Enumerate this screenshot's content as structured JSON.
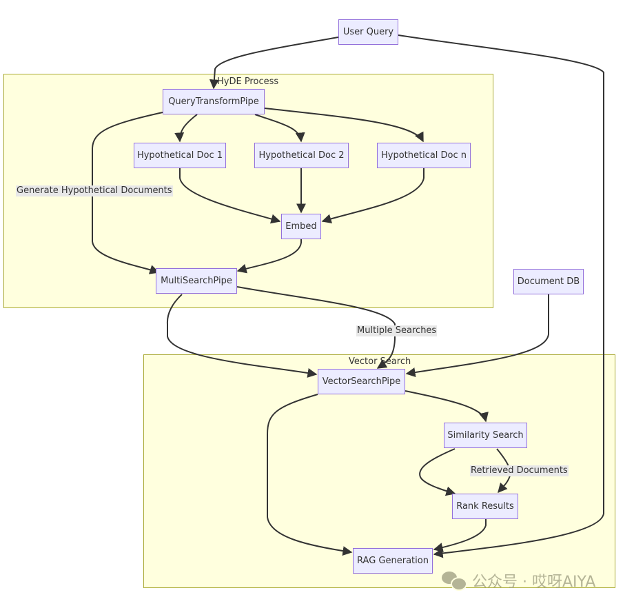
{
  "diagram": {
    "type": "flowchart",
    "colors": {
      "node_fill": "#ececff",
      "node_border": "#9370db",
      "cluster_fill": "#ffffde",
      "cluster_border": "#aaaa33",
      "edge": "#333333",
      "edge_label_bg": "#e8e8e8",
      "text": "#333333"
    },
    "clusters": {
      "hyde": {
        "title": "HyDE Process"
      },
      "vector": {
        "title": "Vector Search"
      }
    },
    "nodes": {
      "user_query": "User Query",
      "query_transform": "QueryTransformPipe",
      "hyp_doc_1": "Hypothetical Doc 1",
      "hyp_doc_2": "Hypothetical Doc 2",
      "hyp_doc_n": "Hypothetical Doc n",
      "embed": "Embed",
      "multi_search": "MultiSearchPipe",
      "document_db": "Document DB",
      "vector_search_pipe": "VectorSearchPipe",
      "similarity_search": "Similarity Search",
      "rank_results": "Rank Results",
      "rag_generation": "RAG Generation"
    },
    "edges": [
      {
        "from": "user_query",
        "to": "query_transform",
        "label": ""
      },
      {
        "from": "user_query",
        "to": "rag_generation",
        "label": ""
      },
      {
        "from": "query_transform",
        "to": "hyp_doc_1",
        "label": ""
      },
      {
        "from": "query_transform",
        "to": "hyp_doc_2",
        "label": ""
      },
      {
        "from": "query_transform",
        "to": "hyp_doc_n",
        "label": ""
      },
      {
        "from": "query_transform",
        "to": "multi_search",
        "label": "Generate Hypothetical Documents"
      },
      {
        "from": "hyp_doc_1",
        "to": "embed",
        "label": ""
      },
      {
        "from": "hyp_doc_2",
        "to": "embed",
        "label": ""
      },
      {
        "from": "hyp_doc_n",
        "to": "embed",
        "label": ""
      },
      {
        "from": "embed",
        "to": "multi_search",
        "label": ""
      },
      {
        "from": "multi_search",
        "to": "vector_search_pipe",
        "label": ""
      },
      {
        "from": "multi_search",
        "to": "vector_search_pipe",
        "label": "Multiple Searches"
      },
      {
        "from": "document_db",
        "to": "vector_search_pipe",
        "label": ""
      },
      {
        "from": "vector_search_pipe",
        "to": "similarity_search",
        "label": ""
      },
      {
        "from": "vector_search_pipe",
        "to": "rag_generation",
        "label": ""
      },
      {
        "from": "similarity_search",
        "to": "rank_results",
        "label": ""
      },
      {
        "from": "similarity_search",
        "to": "rank_results",
        "label": "Retrieved Documents"
      },
      {
        "from": "rank_results",
        "to": "rag_generation",
        "label": ""
      }
    ],
    "edge_labels": {
      "generate": "Generate Hypothetical Documents",
      "multiple": "Multiple Searches",
      "retrieved": "Retrieved Documents"
    }
  },
  "watermark": {
    "icon": "wechat-icon",
    "text": "公众号 · 哎呀AIYA"
  }
}
